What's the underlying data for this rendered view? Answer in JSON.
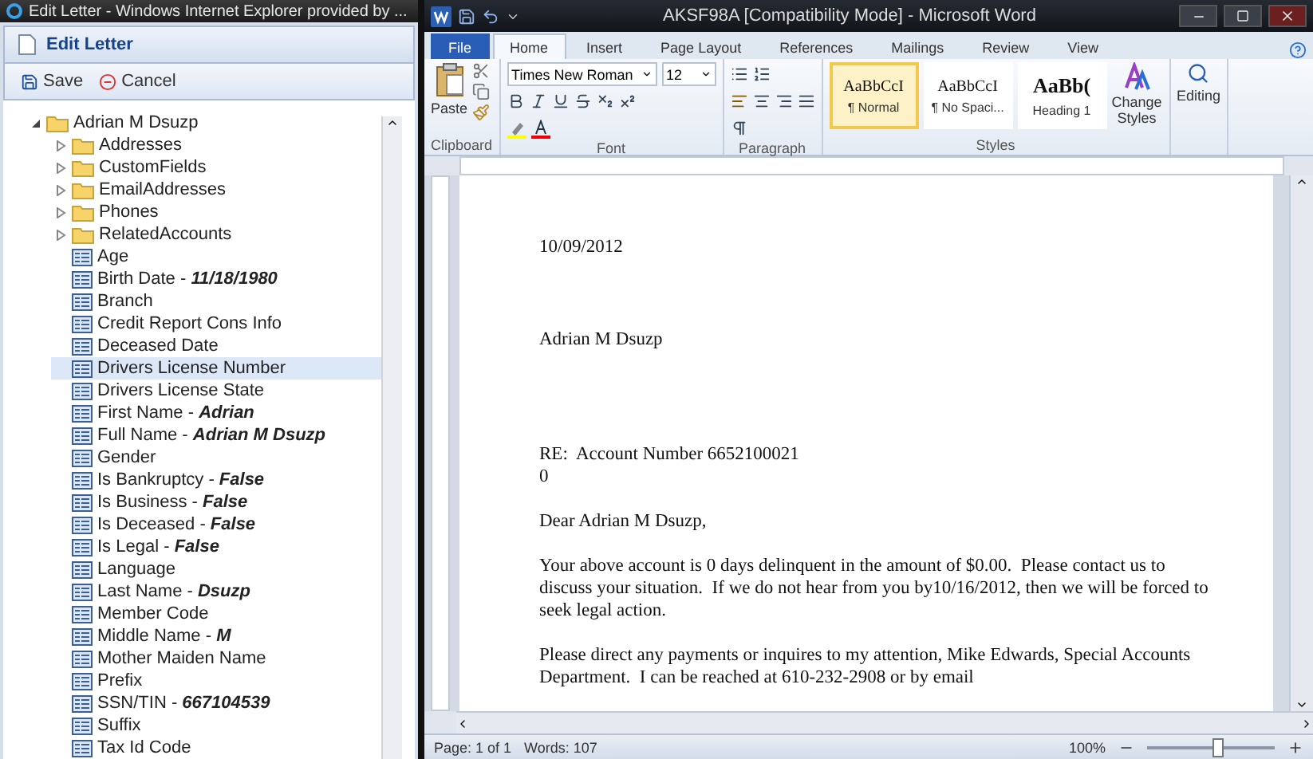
{
  "browser_window": {
    "title": "Edit Letter - Windows Internet Explorer provided by ...",
    "panel_title": "Edit Letter",
    "toolbar": [
      {
        "kind": "save",
        "label": "Save"
      },
      {
        "kind": "cancel",
        "label": "Cancel"
      }
    ],
    "tree": {
      "label": "Adrian M Dsuzp",
      "expanded": true,
      "selected": false,
      "children": [
        {
          "kind": "folder",
          "label": "Addresses",
          "expanded": false,
          "selected": false
        },
        {
          "kind": "folder",
          "label": "CustomFields",
          "expanded": false,
          "selected": false
        },
        {
          "kind": "folder",
          "label": "EmailAddresses",
          "expanded": false,
          "selected": false
        },
        {
          "kind": "folder",
          "label": "Phones",
          "expanded": false,
          "selected": false
        },
        {
          "kind": "folder",
          "label": "RelatedAccounts",
          "expanded": false,
          "selected": false
        },
        {
          "kind": "field",
          "label": "Age",
          "selected": false
        },
        {
          "kind": "field",
          "label": "Birth Date - ",
          "value": "11/18/1980",
          "selected": false
        },
        {
          "kind": "field",
          "label": "Branch",
          "selected": false
        },
        {
          "kind": "field",
          "label": "Credit Report Cons Info",
          "selected": false
        },
        {
          "kind": "field",
          "label": "Deceased Date",
          "selected": false
        },
        {
          "kind": "field",
          "label": "Drivers License Number",
          "selected": true
        },
        {
          "kind": "field",
          "label": "Drivers License State",
          "selected": false
        },
        {
          "kind": "field",
          "label": "First Name - ",
          "value": "Adrian",
          "selected": false
        },
        {
          "kind": "field",
          "label": "Full Name - ",
          "value": "Adrian M Dsuzp",
          "selected": false
        },
        {
          "kind": "field",
          "label": "Gender",
          "selected": false
        },
        {
          "kind": "field",
          "label": "Is Bankruptcy - ",
          "value": "False",
          "selected": false
        },
        {
          "kind": "field",
          "label": "Is Business - ",
          "value": "False",
          "selected": false
        },
        {
          "kind": "field",
          "label": "Is Deceased - ",
          "value": "False",
          "selected": false
        },
        {
          "kind": "field",
          "label": "Is Legal - ",
          "value": "False",
          "selected": false
        },
        {
          "kind": "field",
          "label": "Language",
          "selected": false
        },
        {
          "kind": "field",
          "label": "Last Name - ",
          "value": "Dsuzp",
          "selected": false
        },
        {
          "kind": "field",
          "label": "Member Code",
          "selected": false
        },
        {
          "kind": "field",
          "label": "Middle Name - ",
          "value": "M",
          "selected": false
        },
        {
          "kind": "field",
          "label": "Mother Maiden Name",
          "selected": false
        },
        {
          "kind": "field",
          "label": "Prefix",
          "selected": false
        },
        {
          "kind": "field",
          "label": "SSN/TIN - ",
          "value": "667104539",
          "selected": false
        },
        {
          "kind": "field",
          "label": "Suffix",
          "selected": false
        },
        {
          "kind": "field",
          "label": "Tax Id Code",
          "selected": false
        }
      ]
    }
  },
  "word_window": {
    "title": "AKSF98A [Compatibility Mode] - Microsoft Word",
    "tabs": [
      {
        "label": "File",
        "kind": "file",
        "selected": false
      },
      {
        "label": "Home",
        "kind": "tab",
        "selected": true
      },
      {
        "label": "Insert",
        "kind": "tab",
        "selected": false
      },
      {
        "label": "Page Layout",
        "kind": "tab",
        "selected": false
      },
      {
        "label": "References",
        "kind": "tab",
        "selected": false
      },
      {
        "label": "Mailings",
        "kind": "tab",
        "selected": false
      },
      {
        "label": "Review",
        "kind": "tab",
        "selected": false
      },
      {
        "label": "View",
        "kind": "tab",
        "selected": false
      }
    ],
    "ribbon": {
      "clipboard": {
        "paste_label": "Paste",
        "group_label": "Clipboard"
      },
      "font": {
        "font_name": "Times New Roman",
        "font_size": "12",
        "group_label": "Font"
      },
      "paragraph": {
        "group_label": "Paragraph"
      },
      "styles": {
        "items": [
          {
            "sample": "AaBbCcI",
            "name": "¶ Normal",
            "kind": "normal",
            "selected": true
          },
          {
            "sample": "AaBbCcI",
            "name": "¶ No Spaci...",
            "kind": "normal",
            "selected": false
          },
          {
            "sample": "AaBb(",
            "name": "Heading 1",
            "kind": "heading",
            "selected": false
          }
        ],
        "change_styles_label": "Change Styles",
        "group_label": "Styles"
      },
      "editing": {
        "label": "Editing"
      }
    },
    "document": {
      "paragraphs": [
        {
          "kind": "date",
          "text": "10/09/2012"
        },
        {
          "kind": "name",
          "text": "Adrian M Dsuzp"
        },
        {
          "kind": "re",
          "text": "RE:  Account Number 6652100021"
        },
        {
          "kind": "line",
          "text": "0"
        },
        {
          "kind": "para",
          "text": "Dear Adrian M Dsuzp,"
        },
        {
          "kind": "para",
          "text": "Your above account is 0 days delinquent in the amount of $0.00.  Please contact us to discuss your situation.  If we do not hear from you by10/16/2012, then we will be forced to seek legal action."
        },
        {
          "kind": "para",
          "text": "Please direct any payments or inquires to my attention, Mike Edwards, Special Accounts Department.  I can be reached at 610-232-2908 or by email"
        }
      ]
    },
    "status_bar": {
      "page": "Page: 1 of 1",
      "words": "Words: 107",
      "zoom": "100%",
      "level": 0.55
    }
  }
}
